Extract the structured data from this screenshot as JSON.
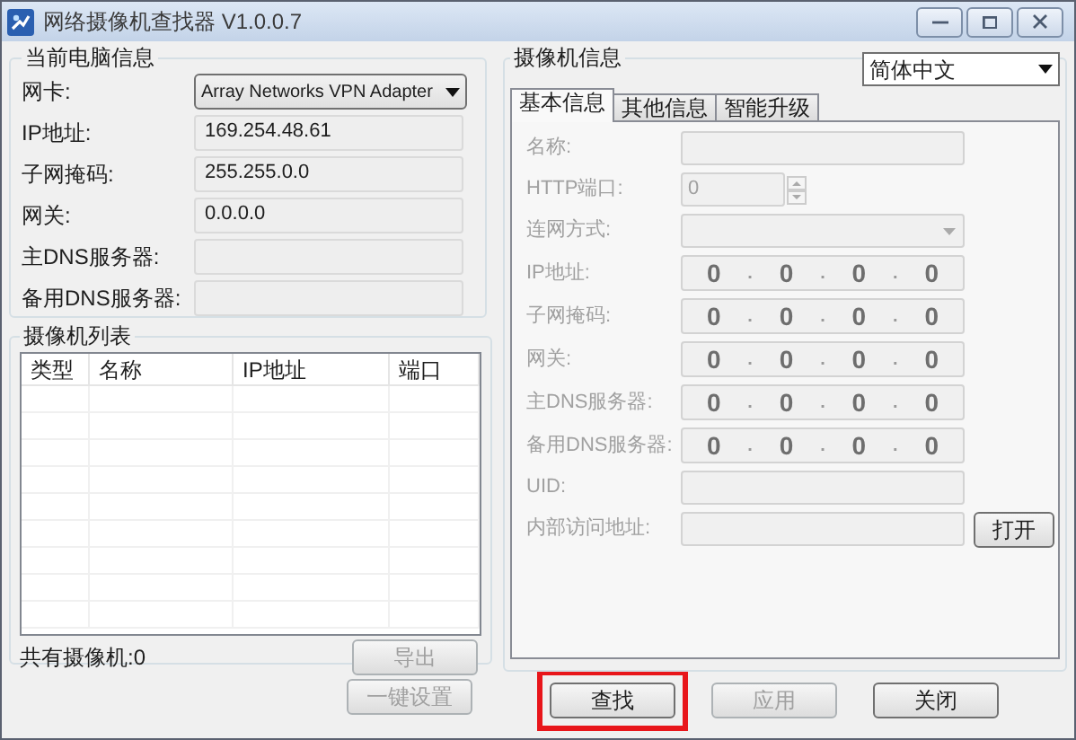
{
  "window": {
    "title": "网络摄像机查找器 V1.0.0.7"
  },
  "pc_info": {
    "title": "当前电脑信息",
    "fields": [
      {
        "label": "网卡:",
        "kind": "dropdown",
        "value": "Array Networks VPN Adapter"
      },
      {
        "label": "IP地址:",
        "kind": "text",
        "value": "169.254.48.61"
      },
      {
        "label": "子网掩码:",
        "kind": "text",
        "value": "255.255.0.0"
      },
      {
        "label": "网关:",
        "kind": "text",
        "value": "0.0.0.0"
      },
      {
        "label": "主DNS服务器:",
        "kind": "text"
      },
      {
        "label": "备用DNS服务器:",
        "kind": "text"
      }
    ]
  },
  "camera_list": {
    "title": "摄像机列表",
    "columns": [
      "类型",
      "名称",
      "IP地址",
      "端口"
    ],
    "count_label": "共有摄像机:0",
    "export_button": {
      "label": "导出",
      "disabled": true
    }
  },
  "one_click_button": {
    "label": "一键设置",
    "disabled": true
  },
  "camera_info": {
    "title": "摄像机信息",
    "language": "简体中文",
    "disabled": true,
    "separator": ".",
    "tabs": [
      {
        "label": "基本信息",
        "selected": true
      },
      {
        "label": "其他信息",
        "selected": false
      },
      {
        "label": "智能升级",
        "selected": false
      }
    ],
    "fields": [
      {
        "label": "名称:",
        "kind": "text"
      },
      {
        "label": "HTTP端口:",
        "kind": "spinner",
        "value": "0"
      },
      {
        "label": "连网方式:",
        "kind": "dropdown"
      },
      {
        "label": "IP地址:",
        "kind": "ip",
        "octets": [
          "0",
          "0",
          "0",
          "0"
        ]
      },
      {
        "label": "子网掩码:",
        "kind": "ip",
        "octets": [
          "0",
          "0",
          "0",
          "0"
        ]
      },
      {
        "label": "网关:",
        "kind": "ip",
        "octets": [
          "0",
          "0",
          "0",
          "0"
        ]
      },
      {
        "label": "主DNS服务器:",
        "kind": "ip",
        "octets": [
          "0",
          "0",
          "0",
          "0"
        ]
      },
      {
        "label": "备用DNS服务器:",
        "kind": "ip",
        "octets": [
          "0",
          "0",
          "0",
          "0"
        ]
      },
      {
        "label": "UID:",
        "kind": "text"
      },
      {
        "label": "内部访问地址:",
        "kind": "text",
        "button": "打开"
      }
    ]
  },
  "buttons": [
    {
      "label": "查找",
      "disabled": false,
      "highlighted": true
    },
    {
      "label": "应用",
      "disabled": true,
      "highlighted": false
    },
    {
      "label": "关闭",
      "disabled": false,
      "highlighted": false
    }
  ]
}
